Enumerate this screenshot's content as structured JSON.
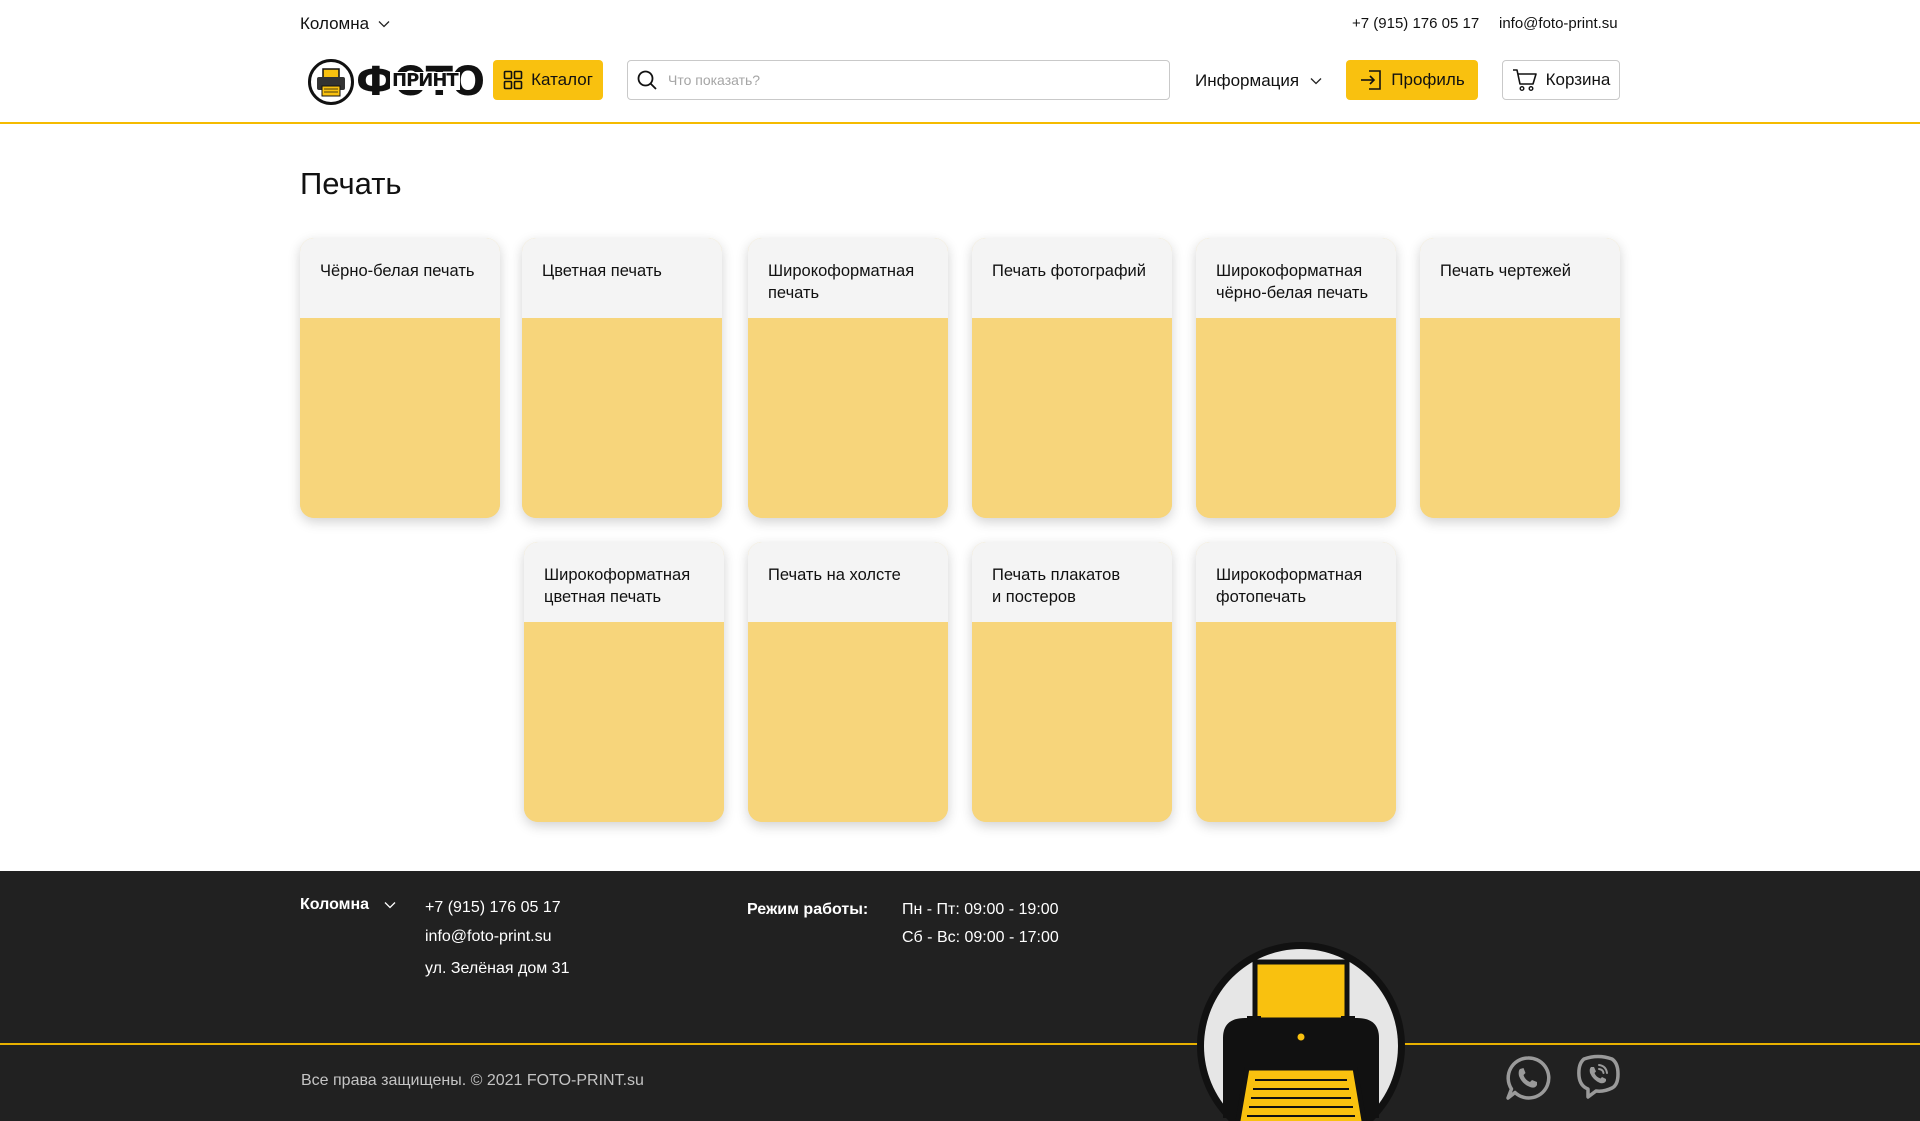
{
  "topbar": {
    "city": "Коломна",
    "phone": "+7 (915) 176 05 17",
    "email": "info@foto-print.su"
  },
  "header": {
    "logo_main": "ФОТО",
    "logo_sub": "ПРИНТ",
    "catalog_label": "Каталог",
    "search_placeholder": "Что показать?",
    "info_label": "Информация",
    "profile_label": "Профиль",
    "cart_label": "Корзина"
  },
  "main": {
    "title": "Печать",
    "cards": [
      {
        "label": "Чёрно-белая печать"
      },
      {
        "label": "Цветная печать"
      },
      {
        "label": "Широкоформатная\nпечать"
      },
      {
        "label": "Печать фотографий"
      },
      {
        "label": "Широкоформатная\nчёрно-белая печать"
      },
      {
        "label": "Печать чертежей"
      },
      {
        "label": "Широкоформатная\nцветная печать"
      },
      {
        "label": "Печать на холсте"
      },
      {
        "label": "Печать плакатов\n и постеров"
      },
      {
        "label": "Широкоформатная\nфотопечать"
      }
    ]
  },
  "footer": {
    "city": "Коломна",
    "phone": "+7 (915) 176 05 17",
    "email": "info@foto-print.su",
    "address": "ул. Зелёная дом 31",
    "hours_label": "Режим работы:",
    "weekdays": "Пн - Пт: 09:00 - 19:00",
    "weekend": "Сб - Вс: 09:00 - 17:00",
    "copyright": "Все права защищены. © 2021 FOTO-PRINT.su"
  },
  "colors": {
    "accent": "#f9c10f",
    "card_body": "#f7d57b",
    "card_head": "#f4f4f4",
    "footer_bg": "#212121",
    "footer_line": "#e8b100"
  },
  "icons": [
    "chevron-down-icon",
    "grid-icon",
    "search-icon",
    "login-icon",
    "cart-icon",
    "whatsapp-icon",
    "viber-icon",
    "printer-logo-icon"
  ]
}
